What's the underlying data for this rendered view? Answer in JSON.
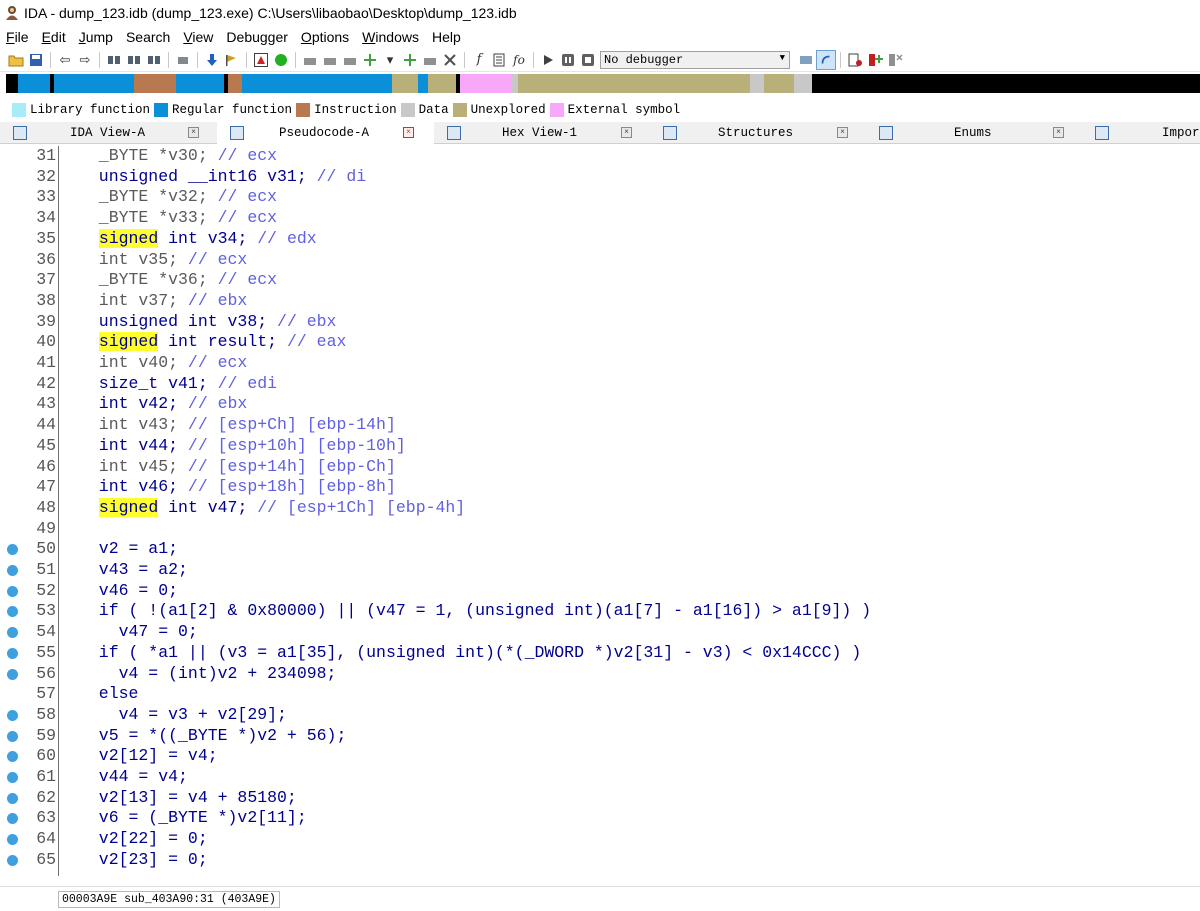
{
  "window": {
    "title": "IDA - dump_123.idb (dump_123.exe) C:\\Users\\libaobao\\Desktop\\dump_123.idb"
  },
  "menu": [
    "File",
    "Edit",
    "Jump",
    "Search",
    "View",
    "Debugger",
    "Options",
    "Windows",
    "Help"
  ],
  "menu_underline": [
    "F",
    "E",
    "J",
    "",
    "V",
    "",
    "O",
    "W",
    ""
  ],
  "toolbar": {
    "debugger_value": "No debugger",
    "icons": [
      "open-icon",
      "save-icon",
      "back-icon",
      "forward-icon",
      "search-icon",
      "run-icon",
      "pause-icon",
      "stop-icon"
    ]
  },
  "colors": {
    "library_function": "#a8ecf8",
    "regular_function": "#0a8fd8",
    "instruction": "#b87850",
    "data": "#c8c8c8",
    "unexplored": "#b8b078",
    "external_symbol": "#f8a8f8",
    "highlight": "#ffff30",
    "breakpoint_dot": "#3fa0e0"
  },
  "legend": [
    {
      "label": "Library function",
      "color": "#a8ecf8"
    },
    {
      "label": "Regular function",
      "color": "#0a8fd8"
    },
    {
      "label": "Instruction",
      "color": "#b87850"
    },
    {
      "label": "Data",
      "color": "#c8c8c8"
    },
    {
      "label": "Unexplored",
      "color": "#b8b078"
    },
    {
      "label": "External symbol",
      "color": "#f8a8f8"
    }
  ],
  "tabs": [
    {
      "label": "IDA View-A",
      "active": false
    },
    {
      "label": "Pseudocode-A",
      "active": true
    },
    {
      "label": "Hex View-1",
      "active": false
    },
    {
      "label": "Structures",
      "active": false
    },
    {
      "label": "Enums",
      "active": false
    },
    {
      "label": "Impor",
      "active": false
    }
  ],
  "code_lines": [
    {
      "num": "31",
      "dot": false,
      "text": "  _BYTE *v30; // ecx"
    },
    {
      "num": "32",
      "dot": false,
      "text": "  unsigned __int16 v31; // di"
    },
    {
      "num": "33",
      "dot": false,
      "text": "  _BYTE *v32; // ecx"
    },
    {
      "num": "34",
      "dot": false,
      "text": "  _BYTE *v33; // ecx"
    },
    {
      "num": "35",
      "dot": false,
      "text": "  signed int v34; // edx"
    },
    {
      "num": "36",
      "dot": false,
      "text": "  int v35; // ecx"
    },
    {
      "num": "37",
      "dot": false,
      "text": "  _BYTE *v36; // ecx"
    },
    {
      "num": "38",
      "dot": false,
      "text": "  int v37; // ebx"
    },
    {
      "num": "39",
      "dot": false,
      "text": "  unsigned int v38; // ebx"
    },
    {
      "num": "40",
      "dot": false,
      "text": "  signed int result; // eax"
    },
    {
      "num": "41",
      "dot": false,
      "text": "  int v40; // ecx"
    },
    {
      "num": "42",
      "dot": false,
      "text": "  size_t v41; // edi"
    },
    {
      "num": "43",
      "dot": false,
      "text": "  int v42; // ebx"
    },
    {
      "num": "44",
      "dot": false,
      "text": "  int v43; // [esp+Ch] [ebp-14h]"
    },
    {
      "num": "45",
      "dot": false,
      "text": "  int v44; // [esp+10h] [ebp-10h]"
    },
    {
      "num": "46",
      "dot": false,
      "text": "  int v45; // [esp+14h] [ebp-Ch]"
    },
    {
      "num": "47",
      "dot": false,
      "text": "  int v46; // [esp+18h] [ebp-8h]"
    },
    {
      "num": "48",
      "dot": false,
      "text": "  signed int v47; // [esp+1Ch] [ebp-4h]"
    },
    {
      "num": "49",
      "dot": false,
      "text": ""
    },
    {
      "num": "50",
      "dot": true,
      "text": "  v2 = a1;"
    },
    {
      "num": "51",
      "dot": true,
      "text": "  v43 = a2;"
    },
    {
      "num": "52",
      "dot": true,
      "text": "  v46 = 0;"
    },
    {
      "num": "53",
      "dot": true,
      "text": "  if ( !(a1[2] & 0x80000) || (v47 = 1, (unsigned int)(a1[7] - a1[16]) > a1[9]) )"
    },
    {
      "num": "54",
      "dot": true,
      "text": "    v47 = 0;"
    },
    {
      "num": "55",
      "dot": true,
      "text": "  if ( *a1 || (v3 = a1[35], (unsigned int)(*(_DWORD *)v2[31] - v3) < 0x14CCC) )"
    },
    {
      "num": "56",
      "dot": true,
      "text": "    v4 = (int)v2 + 234098;"
    },
    {
      "num": "57",
      "dot": false,
      "text": "  else"
    },
    {
      "num": "58",
      "dot": true,
      "text": "    v4 = v3 + v2[29];"
    },
    {
      "num": "59",
      "dot": true,
      "text": "  v5 = *((_BYTE *)v2 + 56);"
    },
    {
      "num": "60",
      "dot": true,
      "text": "  v2[12] = v4;"
    },
    {
      "num": "61",
      "dot": true,
      "text": "  v44 = v4;"
    },
    {
      "num": "62",
      "dot": true,
      "text": "  v2[13] = v4 + 85180;"
    },
    {
      "num": "63",
      "dot": true,
      "text": "  v6 = (_BYTE *)v2[11];"
    },
    {
      "num": "64",
      "dot": true,
      "text": "  v2[22] = 0;"
    },
    {
      "num": "65",
      "dot": true,
      "text": "  v2[23] = 0;"
    }
  ],
  "status": {
    "text": "00003A9E sub_403A90:31 (403A9E)"
  }
}
